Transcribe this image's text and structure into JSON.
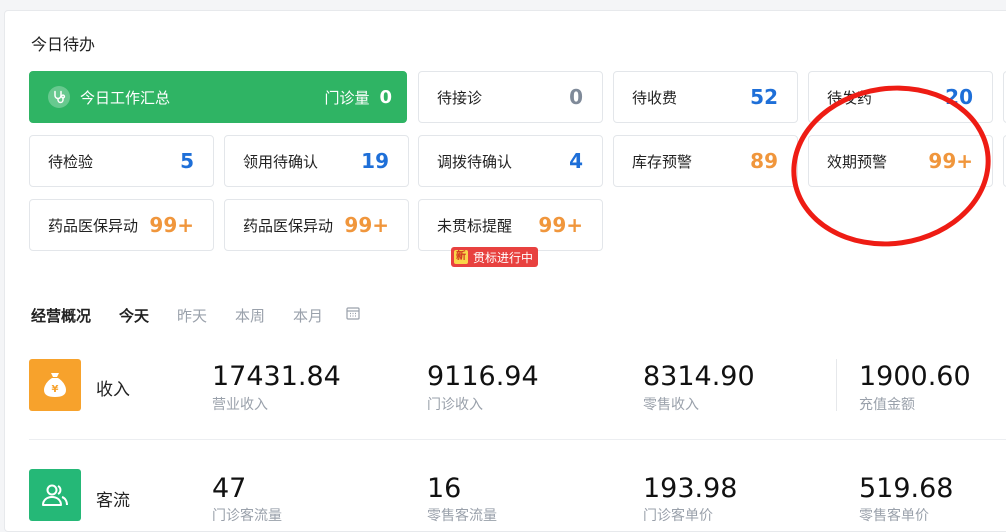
{
  "todo": {
    "title": "今日待办",
    "summary": {
      "label": "今日工作汇总",
      "visits_label": "门诊量",
      "visits_value": "0"
    },
    "cards": [
      {
        "label": "待接诊",
        "value": "0"
      },
      {
        "label": "待收费",
        "value": "52"
      },
      {
        "label": "待发药",
        "value": "20"
      },
      {
        "label": "待检验",
        "value": "5"
      },
      {
        "label": "领用待确认",
        "value": "19"
      },
      {
        "label": "调拨待确认",
        "value": "4"
      },
      {
        "label": "库存预警",
        "value": "89"
      },
      {
        "label": "效期预警",
        "value": "99+"
      },
      {
        "label": "药品医保异动",
        "value": "99+"
      },
      {
        "label": "药品医保异动",
        "value": "99+"
      },
      {
        "label": "未贯标提醒",
        "value": "99+"
      }
    ],
    "badge": {
      "new": "新",
      "text": "贯标进行中"
    }
  },
  "overview": {
    "title": "经营概况",
    "tabs": [
      "今天",
      "昨天",
      "本周",
      "本月"
    ],
    "active_tab": "今天",
    "income": {
      "label": "收入",
      "metrics": [
        {
          "value": "17431.84",
          "label": "营业收入"
        },
        {
          "value": "9116.94",
          "label": "门诊收入"
        },
        {
          "value": "8314.90",
          "label": "零售收入"
        },
        {
          "value": "1900.60",
          "label": "充值金额"
        }
      ]
    },
    "traffic": {
      "label": "客流",
      "metrics": [
        {
          "value": "47",
          "label": "门诊客流量"
        },
        {
          "value": "16",
          "label": "零售客流量"
        },
        {
          "value": "193.98",
          "label": "门诊客单价"
        },
        {
          "value": "519.68",
          "label": "零售客单价"
        }
      ]
    }
  },
  "colors": {
    "summary_green": "#2fb464",
    "value_blue": "#1e6fd8",
    "value_orange": "#f0963c",
    "income_icon": "#f7a22c",
    "traffic_icon": "#25b877",
    "annotation_red": "#ee1c14"
  }
}
